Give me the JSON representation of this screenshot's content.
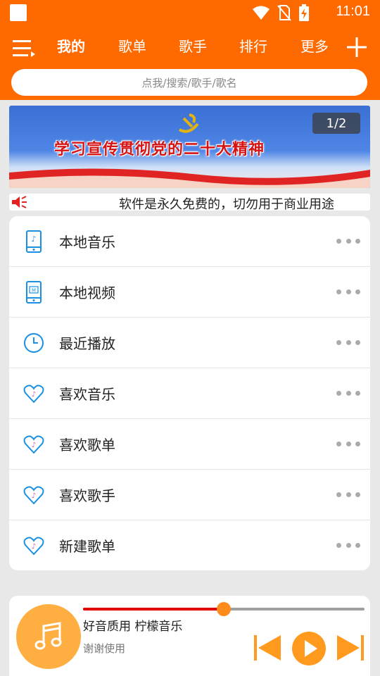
{
  "status_bar": {
    "time": "11:01",
    "icons": [
      "app-square-icon",
      "wifi-icon",
      "no-sim-icon",
      "battery-charging-icon"
    ]
  },
  "colors": {
    "accent": "#ff6a00",
    "icon_blue": "#1a8fe3",
    "heart_note": "#e05a9c",
    "player_orange": "#ff9a1f",
    "progress_red": "#e00000"
  },
  "header": {
    "tabs": [
      {
        "label": "我的",
        "active": true
      },
      {
        "label": "歌单",
        "active": false
      },
      {
        "label": "歌手",
        "active": false
      },
      {
        "label": "排行",
        "active": false
      },
      {
        "label": "更多",
        "active": false
      }
    ],
    "menu_icon": "hamburger-menu-icon",
    "add_icon": "plus-icon",
    "search_placeholder": "点我/搜索/歌手/歌名"
  },
  "banner": {
    "title": "学习宣传贯彻党的二十大精神",
    "counter": "1/2"
  },
  "notice": {
    "icon": "speaker-icon",
    "text": "软件是永久免费的，切勿用于商业用途"
  },
  "menu": {
    "items": [
      {
        "label": "本地音乐",
        "icon": "local-music-icon"
      },
      {
        "label": "本地视频",
        "icon": "local-video-icon"
      },
      {
        "label": "最近播放",
        "icon": "clock-icon"
      },
      {
        "label": "喜欢音乐",
        "icon": "heart-icon"
      },
      {
        "label": "喜欢歌单",
        "icon": "heart-icon"
      },
      {
        "label": "喜欢歌手",
        "icon": "heart-icon"
      },
      {
        "label": "新建歌单",
        "icon": "heart-icon"
      }
    ],
    "more_icon": "more-dots-icon"
  },
  "player": {
    "title": "好音质用 柠檬音乐",
    "subtitle": "谢谢使用",
    "progress": 0.5,
    "cover_icon": "music-note-icon"
  }
}
